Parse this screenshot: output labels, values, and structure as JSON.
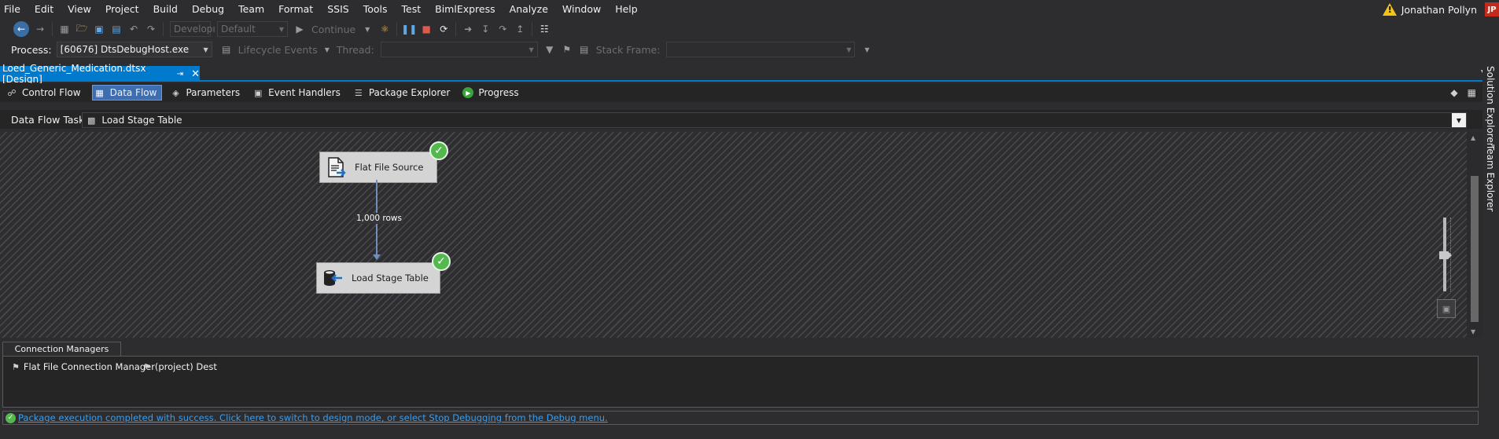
{
  "menu": [
    "File",
    "Edit",
    "View",
    "Project",
    "Build",
    "Debug",
    "Team",
    "Format",
    "SSIS",
    "Tools",
    "Test",
    "BimlExpress",
    "Analyze",
    "Window",
    "Help"
  ],
  "user": {
    "name": "Jonathan Pollyn",
    "initials": "JP",
    "warning_glyph": "!"
  },
  "toolbar": {
    "config_combo": "Developı",
    "platform_combo": "Default",
    "continue_label": "Continue",
    "process_label": "Process:",
    "process_value": "[60676] DtsDebugHost.exe",
    "lifecycle_label": "Lifecycle Events",
    "thread_label": "Thread:",
    "stack_frame_label": "Stack Frame:"
  },
  "document_tab": {
    "title": "Loed_Generic_Medication.dtsx [Design]",
    "pin_glyph": "⇥",
    "close_glyph": "✕"
  },
  "designer_tabs": [
    {
      "label": "Control Flow",
      "icon": "control-flow-icon",
      "glyph": "☍",
      "active": false
    },
    {
      "label": "Data Flow",
      "icon": "data-flow-icon",
      "glyph": "▦",
      "active": true
    },
    {
      "label": "Parameters",
      "icon": "parameters-icon",
      "glyph": "◈",
      "active": false
    },
    {
      "label": "Event Handlers",
      "icon": "event-handlers-icon",
      "glyph": "▣",
      "active": false
    },
    {
      "label": "Package Explorer",
      "icon": "package-explorer-icon",
      "glyph": "☰",
      "active": false
    },
    {
      "label": "Progress",
      "icon": "progress-icon",
      "glyph": "▶",
      "active": false
    }
  ],
  "data_flow_task": {
    "label": "Data Flow Task:",
    "value": "Load Stage Table"
  },
  "components": {
    "source": {
      "label": "Flat File Source",
      "status": "success",
      "check": "✓"
    },
    "destination": {
      "label": "Load Stage Table",
      "status": "success",
      "check": "✓"
    },
    "path_rows": "1,000 rows"
  },
  "connection_managers": {
    "tab_label": "Connection Managers",
    "items": [
      {
        "label": "Flat File Connection Manager",
        "icon": "flat-file-connection-icon",
        "glyph": "⚑"
      },
      {
        "label": "(project) Dest",
        "icon": "database-connection-icon",
        "glyph": "⚑"
      }
    ]
  },
  "status_message": "Package execution completed with success. Click here to switch to design mode, or select Stop Debugging from the Debug menu.",
  "side_panels": [
    "Solution Explorer",
    "Team Explorer"
  ],
  "colors": {
    "accent": "#007acc",
    "success": "#55b84f",
    "link": "#3d9ce8",
    "background": "#2d2d30"
  }
}
